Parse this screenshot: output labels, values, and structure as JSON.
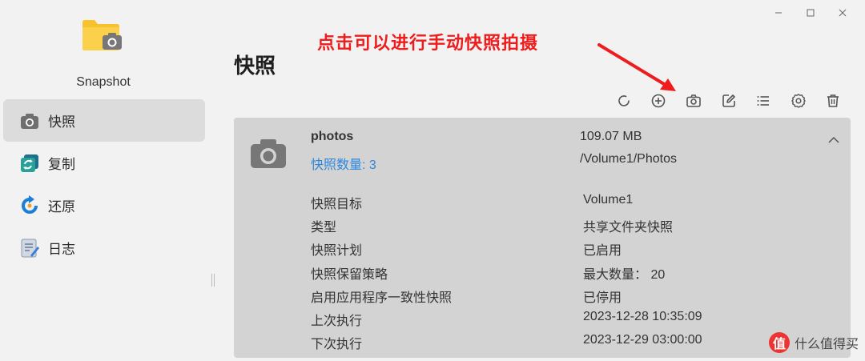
{
  "app": {
    "name": "Snapshot"
  },
  "window": {
    "controls": [
      "minimize-icon",
      "maximize-icon",
      "close-icon"
    ]
  },
  "sidebar": {
    "items": [
      {
        "label": "快照",
        "icon": "camera-icon",
        "active": true
      },
      {
        "label": "复制",
        "icon": "replicate-icon",
        "active": false
      },
      {
        "label": "还原",
        "icon": "restore-icon",
        "active": false
      },
      {
        "label": "日志",
        "icon": "log-icon",
        "active": false
      }
    ]
  },
  "annotation": {
    "text": "点击可以进行手动快照拍摄",
    "color": "#ee1c1c"
  },
  "page": {
    "title": "快照"
  },
  "toolbar": {
    "buttons": [
      "refresh-icon",
      "add-icon",
      "take-snapshot-icon",
      "edit-icon",
      "list-icon",
      "settings-icon",
      "delete-icon"
    ]
  },
  "share": {
    "name": "photos",
    "count_text": "快照数量: 3",
    "size": "109.07 MB",
    "path": "/Volume1/Photos",
    "details": [
      {
        "label": "快照目标",
        "value": "Volume1"
      },
      {
        "label": "类型",
        "value": "共享文件夹快照"
      },
      {
        "label": "快照计划",
        "value": "已启用"
      },
      {
        "label": "快照保留策略",
        "value": "最大数量： 20"
      },
      {
        "label": "启用应用程序一致性快照",
        "value": "已停用"
      },
      {
        "label": "上次执行",
        "value": "2023-12-28 10:35:09"
      },
      {
        "label": "下次执行",
        "value": "2023-12-29 03:00:00"
      }
    ]
  },
  "watermark": {
    "badge": "值",
    "text": "什么值得买"
  },
  "colors": {
    "accent": "#2e86de",
    "card_bg": "#d3d3d3",
    "active_nav": "#dcdcdc",
    "annotation": "#ee1c1c"
  }
}
